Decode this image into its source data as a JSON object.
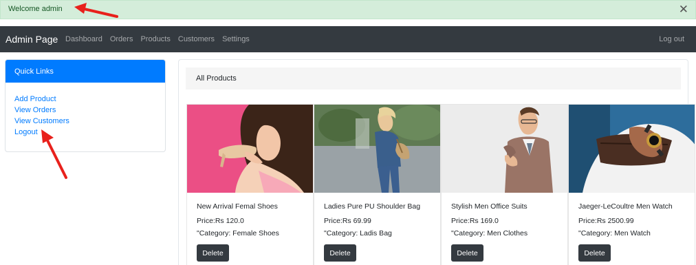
{
  "alert": {
    "message": "Welcome admin",
    "close_glyph": "✕"
  },
  "navbar": {
    "brand": "Admin Page",
    "links": [
      "Dashboard",
      "Orders",
      "Products",
      "Customers",
      "Settings"
    ],
    "logout": "Log out"
  },
  "quick_links": {
    "title": "Quick Links",
    "items": [
      "Add Product",
      "View Orders",
      "View Customers",
      "Logout"
    ]
  },
  "products": {
    "header": "All Products",
    "delete_label": "Delete",
    "items": [
      {
        "name": "New Arrival Femal Shoes",
        "price": "Price:Rs 120.0",
        "category": "\"Category: Female Shoes"
      },
      {
        "name": "Ladies Pure PU Shoulder Bag",
        "price": "Price:Rs 69.99",
        "category": "\"Category: Ladis Bag"
      },
      {
        "name": "Stylish Men Office Suits",
        "price": "Price:Rs 169.0",
        "category": "\"Category: Men Clothes"
      },
      {
        "name": "Jaeger-LeCoultre Men Watch",
        "price": "Price:Rs 2500.99",
        "category": "\"Category: Men Watch"
      }
    ]
  },
  "colors": {
    "alert_bg": "#d4edda",
    "navbar_bg": "#343a40",
    "primary": "#007bff",
    "annotation_arrow": "#e8211c"
  }
}
